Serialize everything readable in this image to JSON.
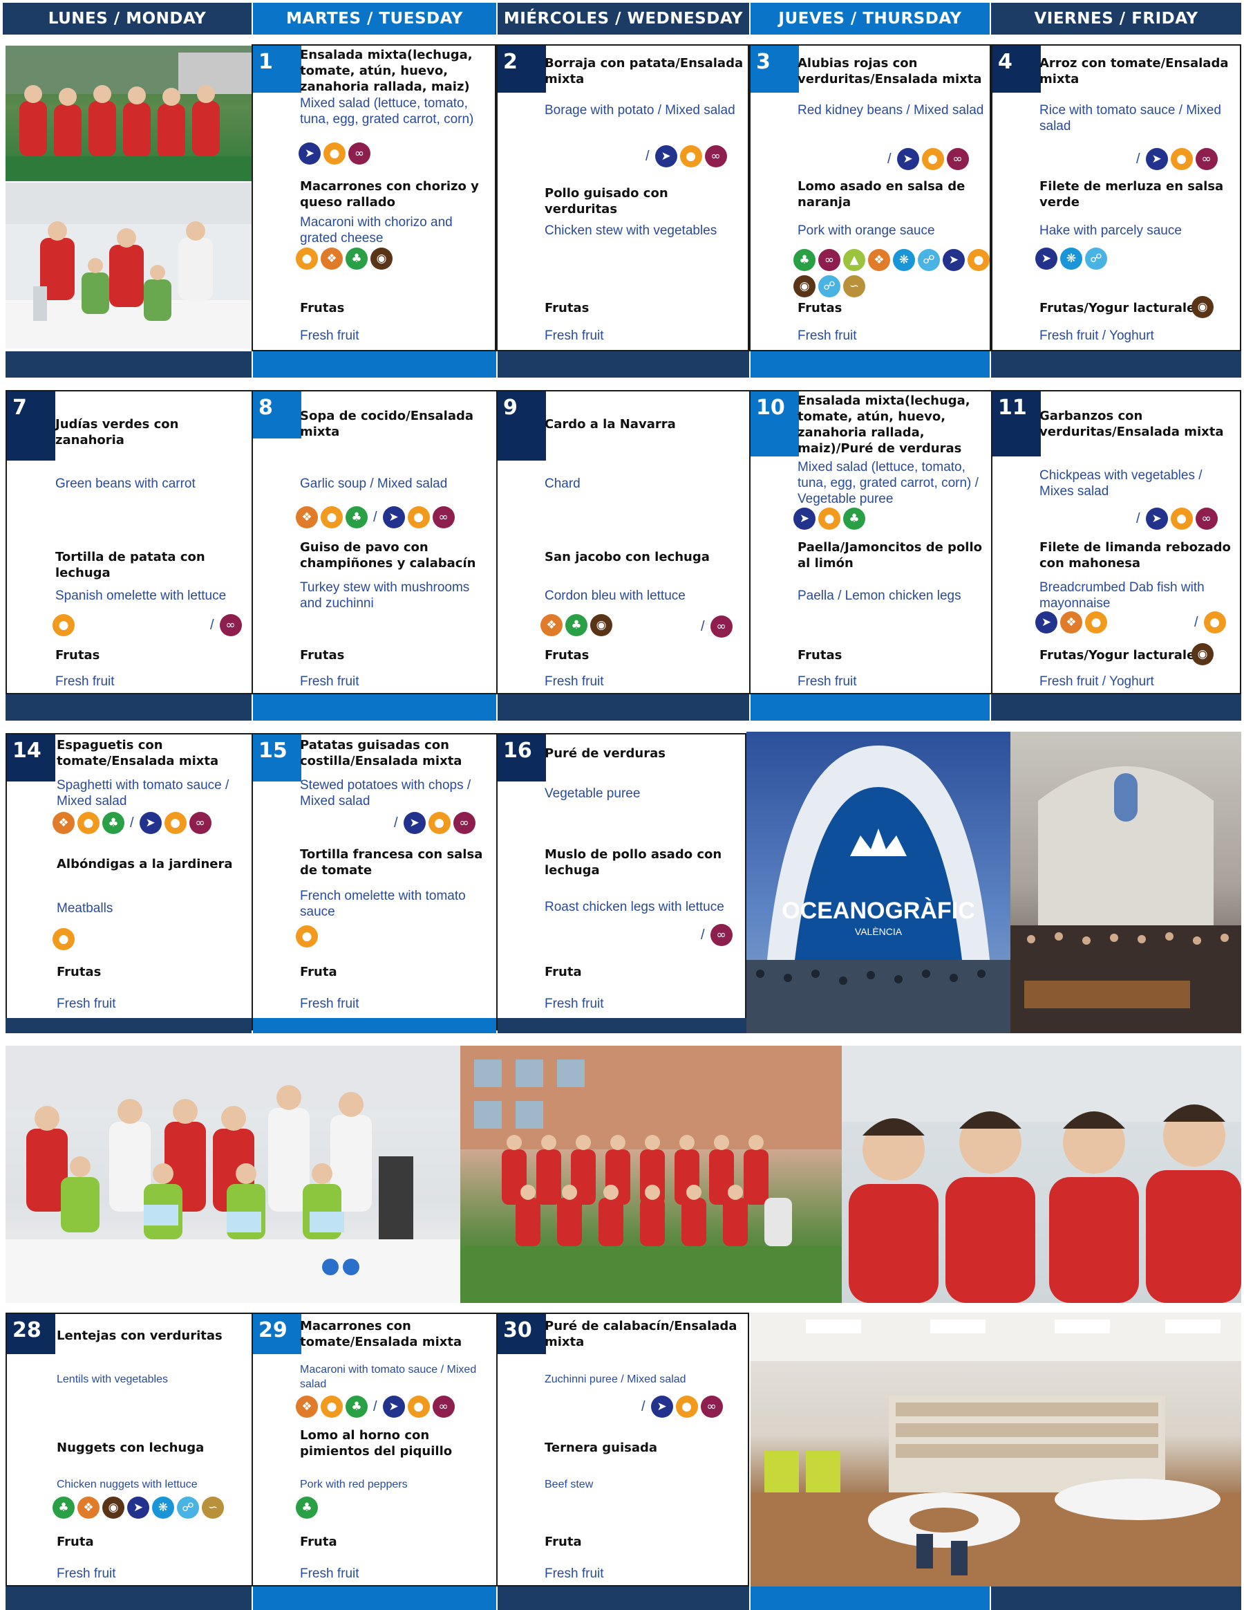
{
  "header": {
    "days": [
      "LUNES / MONDAY",
      "MARTES / TUESDAY",
      "MIÉRCOLES / WEDNESDAY",
      "JUEVES / THURSDAY",
      "VIERNES / FRIDAY"
    ]
  },
  "colors": {
    "dark": "#1c3c66",
    "blue": "#0a74c9",
    "fish": "#23328c",
    "egg": "#f29a1d",
    "sulfite": "#8e1e4e",
    "gluten": "#e07b2a",
    "celery": "#2aa046",
    "milk": "#5a3417",
    "crustacean": "#1995d8",
    "mollusc": "#49b3e4",
    "mustard": "#9bc33d",
    "sesame": "#b8913a"
  },
  "week1": {
    "d1": {
      "num": "1",
      "l1es": "Ensalada mixta(lechuga, tomate, atún, huevo, zanahoria rallada, maiz)",
      "l1en": "Mixed salad (lettuce, tomato, tuna, egg, grated carrot, corn)",
      "l2es": "Macarrones con chorizo y queso rallado",
      "l2en": "Macaroni with chorizo and grated cheese",
      "l3es": "Frutas",
      "l3en": "Fresh fruit"
    },
    "d2": {
      "num": "2",
      "l1es": "Borraja con patata/Ensalada mixta",
      "l1en": "Borage with potato / Mixed salad",
      "l2es": "Pollo guisado con verduritas",
      "l2en": "Chicken stew with vegetables",
      "l3es": "Frutas",
      "l3en": "Fresh fruit"
    },
    "d3": {
      "num": "3",
      "l1es": "Alubias rojas con verduritas/Ensalada mixta",
      "l1en": "Red kidney beans / Mixed salad",
      "l2es": "Lomo asado en salsa de naranja",
      "l2en": "Pork with orange sauce",
      "l3es": "Frutas",
      "l3en": "Fresh fruit"
    },
    "d4": {
      "num": "4",
      "l1es": "Arroz con tomate/Ensalada mixta",
      "l1en": "Rice with tomato sauce / Mixed salad",
      "l2es": "Filete de merluza en salsa verde",
      "l2en": "Hake with parcely sauce",
      "l3es": "Frutas/Yogur lacturale",
      "l3en": "Fresh fruit / Yoghurt"
    }
  },
  "week2": {
    "d7": {
      "num": "7",
      "l1es": "Judías verdes con zanahoria",
      "l1en": "Green beans with carrot",
      "l2es": "Tortilla de patata con lechuga",
      "l2en": "Spanish omelette with lettuce",
      "l3es": "Frutas",
      "l3en": "Fresh fruit"
    },
    "d8": {
      "num": "8",
      "l1es": "Sopa de cocido/Ensalada mixta",
      "l1en": "Garlic soup / Mixed salad",
      "l2es": "Guiso de pavo con champiñones y calabacín",
      "l2en": "Turkey stew with mushrooms and zuchinni",
      "l3es": "Frutas",
      "l3en": "Fresh fruit"
    },
    "d9": {
      "num": "9",
      "l1es": "Cardo a la Navarra",
      "l1en": "Chard",
      "l2es": "San jacobo con lechuga",
      "l2en": "Cordon bleu with lettuce",
      "l3es": "Frutas",
      "l3en": "Fresh fruit"
    },
    "d10": {
      "num": "10",
      "l1es": "Ensalada mixta(lechuga, tomate, atún, huevo, zanahoria rallada, maiz)/Puré de verduras",
      "l1en": "Mixed salad (lettuce, tomato, tuna, egg, grated carrot, corn) / Vegetable puree",
      "l2es": "Paella/Jamoncitos de pollo al limón",
      "l2en": "Paella / Lemon chicken legs",
      "l3es": "Frutas",
      "l3en": "Fresh fruit"
    },
    "d11": {
      "num": "11",
      "l1es": "Garbanzos con verduritas/Ensalada mixta",
      "l1en": "Chickpeas with vegetables / Mixes salad",
      "l2es": "Filete de limanda rebozado con mahonesa",
      "l2en": "Breadcrumbed Dab fish with mayonnaise",
      "l3es": "Frutas/Yogur lacturale",
      "l3en": "Fresh fruit / Yoghurt"
    }
  },
  "week3": {
    "d14": {
      "num": "14",
      "l1es": "Espaguetis con tomate/Ensalada mixta",
      "l1en": "Spaghetti with tomato sauce / Mixed salad",
      "l2es": "Albóndigas a la jardinera",
      "l2en": "Meatballs",
      "l3es": "Frutas",
      "l3en": "Fresh fruit"
    },
    "d15": {
      "num": "15",
      "l1es": "Patatas guisadas con costilla/Ensalada mixta",
      "l1en": "Stewed potatoes with chops / Mixed salad",
      "l2es": "Tortilla francesa con salsa de tomate",
      "l2en": "French omelette with tomato sauce",
      "l3es": "Fruta",
      "l3en": "Fresh fruit"
    },
    "d16": {
      "num": "16",
      "l1es": "Puré de verduras",
      "l1en": "Vegetable puree",
      "l2es": "Muslo de pollo asado con lechuga",
      "l2en": "Roast chicken legs with lettuce",
      "l3es": "Fruta",
      "l3en": "Fresh fruit"
    },
    "photo_text": "OCEANOGRÀFIC",
    "photo_sub": "VALÈNCIA"
  },
  "week5": {
    "d28": {
      "num": "28",
      "l1es": "Lentejas con verduritas",
      "l1en": "Lentils with vegetables",
      "l2es": "Nuggets con lechuga",
      "l2en": "Chicken nuggets with lettuce",
      "l3es": "Fruta",
      "l3en": "Fresh fruit"
    },
    "d29": {
      "num": "29",
      "l1es": "Macarrones con tomate/Ensalada mixta",
      "l1en": "Macaroni with tomato sauce / Mixed salad",
      "l2es": "Lomo al horno con pimientos del piquillo",
      "l2en": "Pork with red peppers",
      "l3es": "Fruta",
      "l3en": "Fresh fruit"
    },
    "d30": {
      "num": "30",
      "l1es": "Puré de calabacín/Ensalada mixta",
      "l1en": "Zuchinni puree / Mixed salad",
      "l2es": "Ternera guisada",
      "l2en": "Beef stew",
      "l3es": "Fruta",
      "l3en": "Fresh fruit"
    }
  },
  "icons": {
    "fish": "fish-icon",
    "egg": "egg-icon",
    "sulfite": "sulfite-icon",
    "gluten": "wheat-icon",
    "celery": "celery-icon",
    "milk": "milk-icon",
    "crustacean": "crab-icon",
    "mollusc": "shell-icon",
    "mustard": "mustard-icon",
    "sesame": "sesame-icon"
  },
  "separator": "/"
}
